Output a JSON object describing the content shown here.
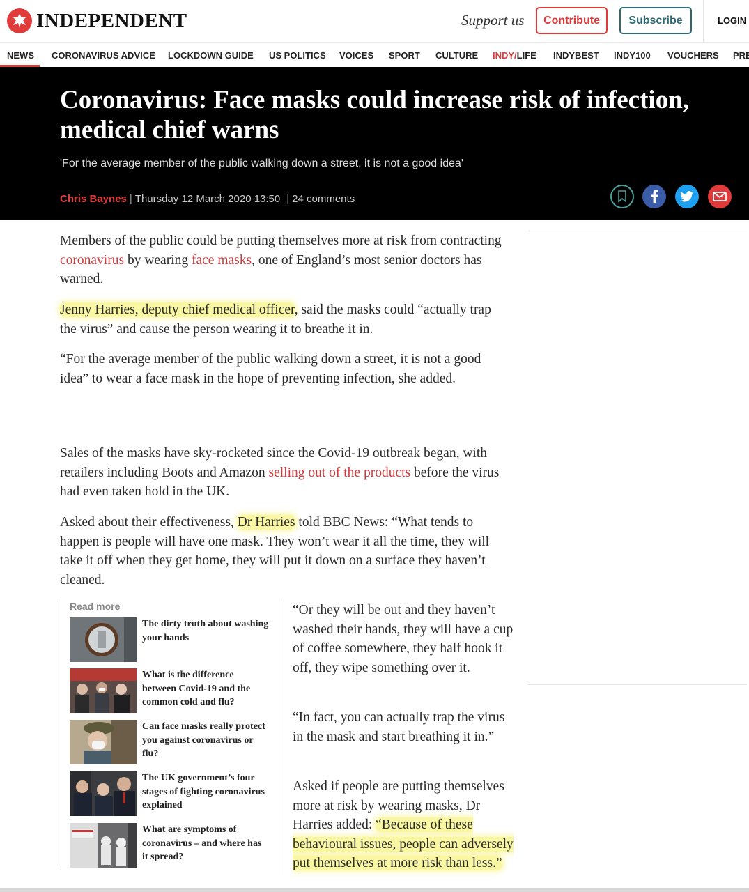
{
  "header": {
    "logo_text": "INDEPENDENT",
    "support_text": "Support us",
    "contribute_label": "Contribute",
    "subscribe_label": "Subscribe",
    "login_label": "LOGIN"
  },
  "nav": {
    "items": [
      {
        "label": "NEWS"
      },
      {
        "label": "CORONAVIRUS ADVICE"
      },
      {
        "label": "LOCKDOWN GUIDE"
      },
      {
        "label": "US POLITICS"
      },
      {
        "label": "VOICES"
      },
      {
        "label": "SPORT"
      },
      {
        "label": "CULTURE"
      },
      {
        "label_a": "INDY/",
        "label_b": "LIFE"
      },
      {
        "label": "INDYBEST"
      },
      {
        "label": "INDY100"
      },
      {
        "label": "VOUCHERS"
      },
      {
        "label": "PRE"
      }
    ],
    "active": "NEWS"
  },
  "article": {
    "headline": "Coronavirus: Face masks could increase risk of infection, medical chief warns",
    "standfirst": "'For the average member of the public walking down a street, it is not a good idea'",
    "author": "Chris Baynes",
    "date": "Thursday 12 March 2020 13:50",
    "comments": "24 comments",
    "p1": {
      "a": "Members of the public could be putting themselves more at risk from contracting ",
      "link1": "coronavirus",
      "b": " by wearing ",
      "link2": "face masks",
      "c": ", one of England’s most senior doctors has warned."
    },
    "p2": {
      "highlight": "Jenny Harries, deputy chief medical officer",
      "rest": ", said the masks could “actually trap the virus” and cause the person wearing it to breathe it in."
    },
    "p3": "“For the average member of the public walking down a street, it is not a good idea” to wear a face mask in the hope of preventing infection, she added.",
    "p4": {
      "a": "Sales of the masks have sky-rocketed since the Covid-19 outbreak began, with retailers including Boots and Amazon ",
      "link": "selling out of the products",
      "b": " before the virus had even taken hold in the UK."
    },
    "p5": {
      "a": "Asked about their effectiveness, ",
      "highlight": "Dr Harries",
      "b": " told BBC News: “What tends to happen is people will have one mask. They won’t wear it all the time, they will take it off when they get home, they will put it down on a surface they haven’t cleaned."
    },
    "p6": "“Or they will be out and they haven’t washed their hands, they will have a cup of coffee somewhere, they half hook it off, they wipe something over it.",
    "p7": "“In fact, you can actually trap the virus in the mask and start breathing it in.”",
    "p8": {
      "a": "Asked if people are putting themselves more at risk by wearing masks, Dr Harries added: ",
      "highlight": "“Because of these behavioural issues, people can adversely put themselves at more risk than less.”"
    }
  },
  "readmore": {
    "label": "Read more",
    "items": [
      {
        "title": "The dirty truth about washing your hands"
      },
      {
        "title": "What is the difference between Covid-19 and the common cold and flu?"
      },
      {
        "title": "Can face masks really protect you against coronavirus or flu?"
      },
      {
        "title": "The UK government’s four stages of fighting coronavirus explained"
      },
      {
        "title": "What are symptoms of coronavirus – and where has it spread?"
      }
    ]
  },
  "colors": {
    "brand_red": "#e03a3a",
    "subscribe_teal": "#2d6a73",
    "highlight_yellow": "#f6f05a"
  }
}
